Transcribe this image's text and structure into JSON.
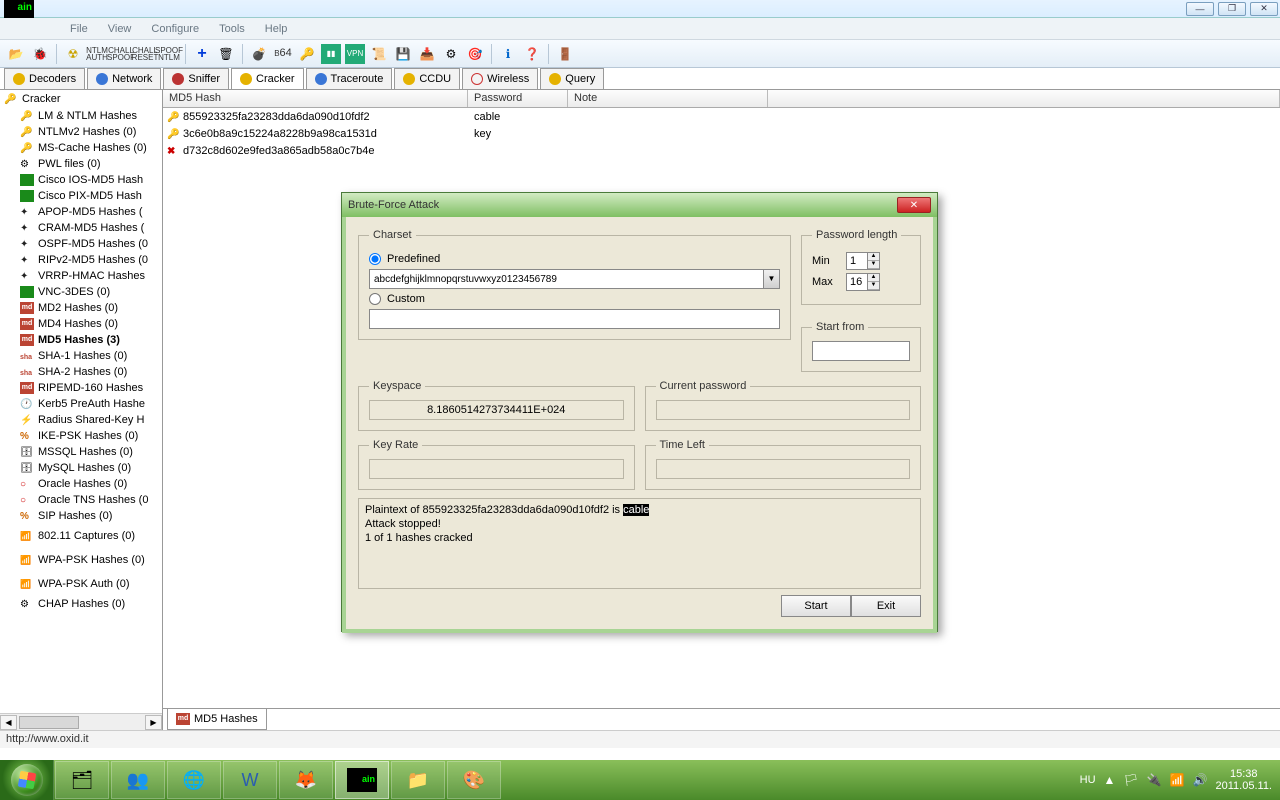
{
  "menus": [
    "File",
    "View",
    "Configure",
    "Tools",
    "Help"
  ],
  "tabs": [
    {
      "label": "Decoders",
      "icon": "key"
    },
    {
      "label": "Network",
      "icon": "globe"
    },
    {
      "label": "Sniffer",
      "icon": "sniff"
    },
    {
      "label": "Cracker",
      "icon": "key",
      "active": true
    },
    {
      "label": "Traceroute",
      "icon": "globe"
    },
    {
      "label": "CCDU",
      "icon": "green"
    },
    {
      "label": "Wireless",
      "icon": "radio"
    },
    {
      "label": "Query",
      "icon": "db"
    }
  ],
  "sidebar": {
    "root": "Cracker",
    "items": [
      {
        "label": "LM & NTLM Hashes",
        "icon": "key"
      },
      {
        "label": "NTLMv2 Hashes (0)",
        "icon": "key"
      },
      {
        "label": "MS-Cache Hashes (0)",
        "icon": "key"
      },
      {
        "label": "PWL files (0)",
        "icon": "chap"
      },
      {
        "label": "Cisco IOS-MD5 Hash",
        "icon": "green"
      },
      {
        "label": "Cisco PIX-MD5 Hash",
        "icon": "green"
      },
      {
        "label": "APOP-MD5 Hashes (",
        "icon": "plus"
      },
      {
        "label": "CRAM-MD5 Hashes (",
        "icon": "plus"
      },
      {
        "label": "OSPF-MD5 Hashes (0",
        "icon": "plus"
      },
      {
        "label": "RIPv2-MD5 Hashes (0",
        "icon": "plus"
      },
      {
        "label": "VRRP-HMAC Hashes",
        "icon": "plus"
      },
      {
        "label": "VNC-3DES (0)",
        "icon": "green"
      },
      {
        "label": "MD2 Hashes (0)",
        "icon": "md",
        "tx": "md"
      },
      {
        "label": "MD4 Hashes (0)",
        "icon": "md",
        "tx": "md"
      },
      {
        "label": "MD5 Hashes (3)",
        "icon": "md",
        "tx": "md",
        "sel": true
      },
      {
        "label": "SHA-1 Hashes (0)",
        "icon": "sha"
      },
      {
        "label": "SHA-2 Hashes (0)",
        "icon": "sha"
      },
      {
        "label": "RIPEMD-160 Hashes",
        "icon": "md",
        "tx": "md"
      },
      {
        "label": "Kerb5 PreAuth Hashe",
        "icon": "clock"
      },
      {
        "label": "Radius Shared-Key H",
        "icon": "bolt"
      },
      {
        "label": "IKE-PSK Hashes (0)",
        "icon": "perc"
      },
      {
        "label": "MSSQL Hashes (0)",
        "icon": "db"
      },
      {
        "label": "MySQL Hashes (0)",
        "icon": "db"
      },
      {
        "label": "Oracle Hashes (0)",
        "icon": "ora"
      },
      {
        "label": "Oracle TNS Hashes (0",
        "icon": "ora"
      },
      {
        "label": "SIP Hashes (0)",
        "icon": "perc"
      },
      {
        "label": "802.11 Captures (0)",
        "icon": "radio"
      },
      {
        "label": "WPA-PSK Hashes (0)",
        "icon": "radio"
      },
      {
        "label": "WPA-PSK Auth (0)",
        "icon": "radio"
      },
      {
        "label": "CHAP Hashes (0)",
        "icon": "chap"
      }
    ]
  },
  "table": {
    "headers": [
      "MD5 Hash",
      "Password",
      "Note"
    ],
    "rows": [
      {
        "hash": "855923325fa23283dda6da090d10fdf2",
        "pw": "cable",
        "icon": "key"
      },
      {
        "hash": "3c6e0b8a9c15224a8228b9a98ca1531d",
        "pw": "key",
        "icon": "key"
      },
      {
        "hash": "d732c8d602e9fed3a865adb58a0c7b4e",
        "pw": "",
        "icon": "x"
      }
    ]
  },
  "bottom_tab": "MD5 Hashes",
  "status": "http://www.oxid.it",
  "dialog": {
    "title": "Brute-Force Attack",
    "charset_legend": "Charset",
    "predefined": "Predefined",
    "custom": "Custom",
    "charset_value": "abcdefghijklmnopqrstuvwxyz0123456789",
    "pwdlen_legend": "Password length",
    "min_label": "Min",
    "min_value": "1",
    "max_label": "Max",
    "max_value": "16",
    "startfrom_legend": "Start from",
    "keyspace_legend": "Keyspace",
    "keyspace_value": "8.1860514273734411E+024",
    "curpwd_legend": "Current password",
    "keyrate_legend": "Key Rate",
    "timeleft_legend": "Time Left",
    "log_pre": "Plaintext of 855923325fa23283dda6da090d10fdf2 is ",
    "log_hl": "cable",
    "log_post": "Attack stopped!\n1 of 1 hashes cracked",
    "start": "Start",
    "exit": "Exit"
  },
  "tray": {
    "lang": "HU",
    "time": "15:38",
    "date": "2011.05.11."
  }
}
